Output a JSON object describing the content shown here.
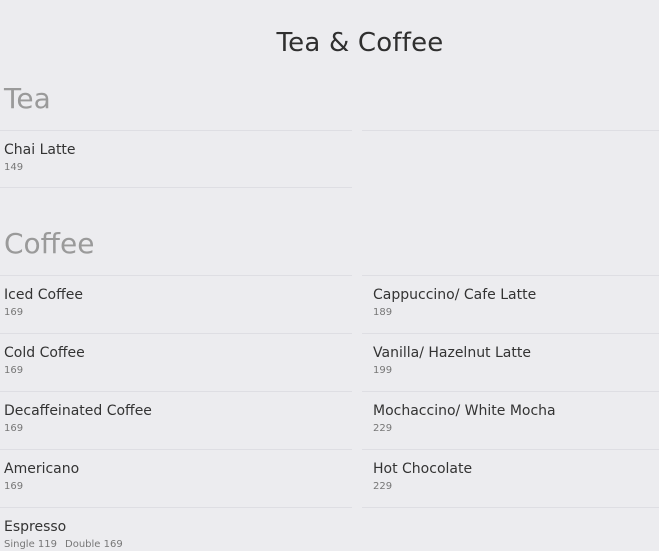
{
  "title": "Tea & Coffee",
  "sections": {
    "tea": {
      "title": "Tea",
      "items": [
        {
          "name": "Chai Latte",
          "price": "149"
        }
      ]
    },
    "coffee": {
      "title": "Coffee",
      "left": [
        {
          "name": "Iced Coffee",
          "price": "169"
        },
        {
          "name": "Cold Coffee",
          "price": "169"
        },
        {
          "name": "Decaffeinated Coffee",
          "price": "169"
        },
        {
          "name": "Americano",
          "price": "169"
        },
        {
          "name": "Espresso",
          "price_single": "Single 119",
          "price_double": "Double 169"
        }
      ],
      "right": [
        {
          "name": "Cappuccino/ Cafe Latte",
          "price": "189"
        },
        {
          "name": "Vanilla/ Hazelnut Latte",
          "price": "199"
        },
        {
          "name": "Mochaccino/ White Mocha",
          "price": "229"
        },
        {
          "name": "Hot Chocolate",
          "price": "229"
        }
      ]
    }
  }
}
